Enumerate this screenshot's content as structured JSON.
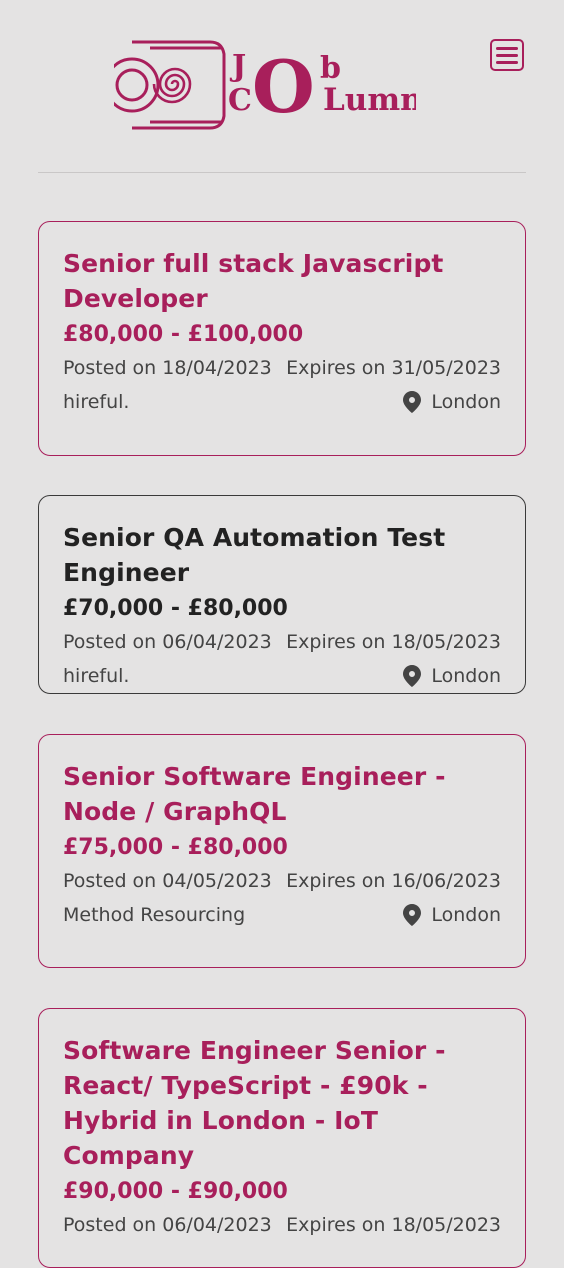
{
  "header": {
    "menu_icon": "hamburger-menu-icon"
  },
  "logo": {
    "letters": {
      "j": "J",
      "o": "O",
      "b": "b",
      "c": "C",
      "lumn": "Lumn"
    }
  },
  "colors": {
    "accent": "#a81f5b",
    "text": "#444444",
    "dark_text": "#222222",
    "background": "#e4e3e3"
  },
  "jobs": [
    {
      "title": "Senior full stack Javascript Developer",
      "salary": "£80,000 - £100,000",
      "posted": "Posted on 18/04/2023",
      "expires": "Expires on 31/05/2023",
      "company": "hireful.",
      "location": "London"
    },
    {
      "title": "Senior QA Automation Test Engineer",
      "salary": "£70,000 - £80,000",
      "posted": "Posted on 06/04/2023",
      "expires": "Expires on 18/05/2023",
      "company": "hireful.",
      "location": "London"
    },
    {
      "title": "Senior Software Engineer - Node / GraphQL",
      "salary": "£75,000 - £80,000",
      "posted": "Posted on 04/05/2023",
      "expires": "Expires on 16/06/2023",
      "company": "Method Resourcing",
      "location": "London"
    },
    {
      "title": "Software Engineer Senior - React/ TypeScript - £90k - Hybrid in London - IoT Company",
      "salary": "£90,000 - £90,000",
      "posted": "Posted on 06/04/2023",
      "expires": "Expires on 18/05/2023"
    }
  ]
}
